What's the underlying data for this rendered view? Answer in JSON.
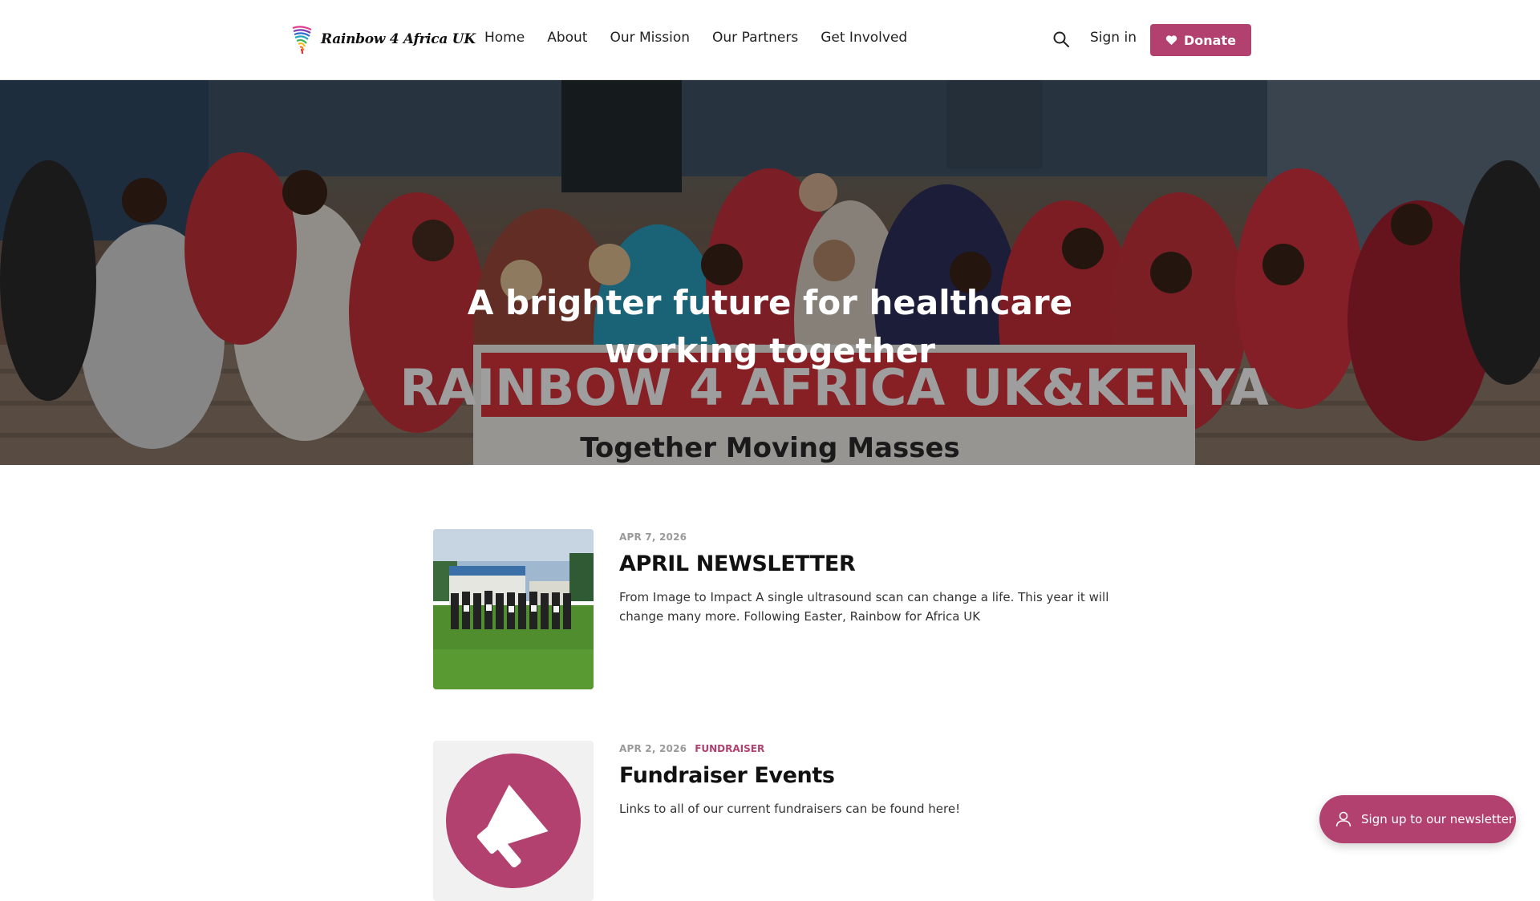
{
  "header": {
    "logo_text": "Rainbow 4 Africa UK",
    "nav": [
      "Home",
      "About",
      "Our Mission",
      "Our Partners",
      "Get Involved"
    ],
    "sign_in": "Sign in",
    "donate": "Donate"
  },
  "hero": {
    "title_line1": "A brighter future for healthcare",
    "title_line2": "working together",
    "photo_banner_text": "RAINBOW 4 AFRICA UK&KENYA",
    "photo_banner_subtext": "Together Moving Masses"
  },
  "posts": [
    {
      "date": "APR 7, 2026",
      "tag": "",
      "title": "APRIL NEWSLETTER",
      "excerpt": "From Image to Impact A single ultrasound scan can change a life. This year it will change many more. Following Easter, Rainbow for Africa UK"
    },
    {
      "date": "APR 2, 2026",
      "tag": "FUNDRAISER",
      "title": "Fundraiser Events",
      "excerpt": "Links to all of our current fundraisers can be found here!"
    }
  ],
  "newsletter": {
    "label": "Sign up to our newsletter"
  },
  "colors": {
    "accent": "#b2416f",
    "text": "#1f1f1f",
    "muted": "#9a9a9a"
  },
  "icons": {
    "search": "search-icon",
    "heart": "heart-icon",
    "user": "user-icon",
    "megaphone": "megaphone-icon"
  }
}
